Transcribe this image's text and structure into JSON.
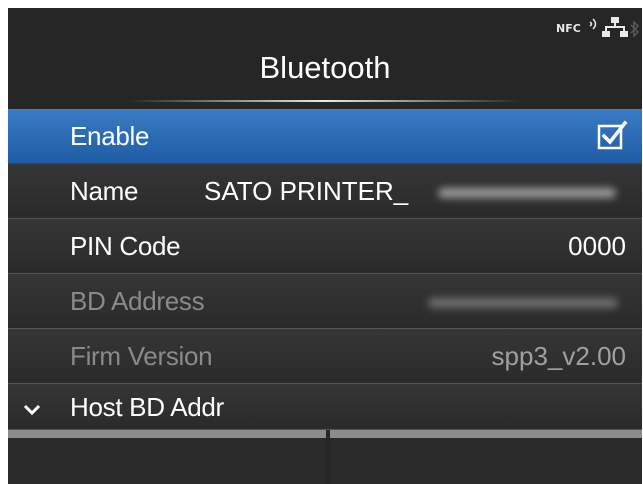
{
  "status": {
    "nfc_label": "NFC"
  },
  "header": {
    "title": "Bluetooth"
  },
  "menu": {
    "items": [
      {
        "label": "Enable",
        "checked": true
      },
      {
        "label": "Name",
        "value": "SATO PRINTER_"
      },
      {
        "label": "PIN Code",
        "value": "0000"
      },
      {
        "label": "BD Address"
      },
      {
        "label": "Firm Version",
        "value": "spp3_v2.00"
      },
      {
        "label": "Host BD Addr"
      }
    ]
  },
  "colors": {
    "selected": "#2b6cb5",
    "background": "#262626",
    "disabled_text": "#8a8a8a"
  }
}
